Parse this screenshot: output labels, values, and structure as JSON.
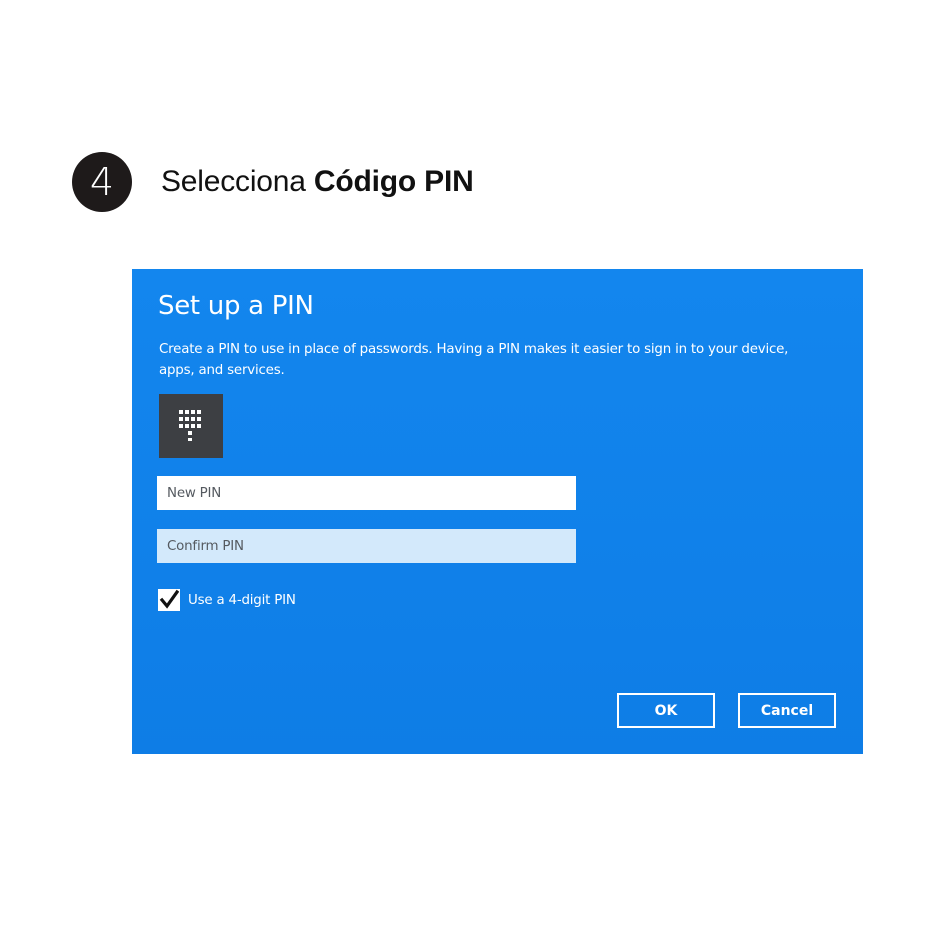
{
  "step": {
    "number": "4",
    "text_prefix": "Selecciona ",
    "text_bold": "Código PIN"
  },
  "dialog": {
    "title": "Set up a PIN",
    "description": "Create a PIN to use in place of passwords. Having a PIN makes it easier to sign in to your device, apps, and services.",
    "icon": "keypad-icon",
    "new_pin": {
      "value": "",
      "placeholder": "New PIN"
    },
    "confirm_pin": {
      "value": "",
      "placeholder": "Confirm PIN"
    },
    "four_digit": {
      "label": "Use a 4-digit PIN",
      "checked": true
    },
    "ok_label": "OK",
    "cancel_label": "Cancel"
  },
  "colors": {
    "dialog_background": "#0f7fe9",
    "keypad_tile": "#3d3f43",
    "confirm_field": "#d3e9fb",
    "step_badge": "#1e1a1a"
  }
}
